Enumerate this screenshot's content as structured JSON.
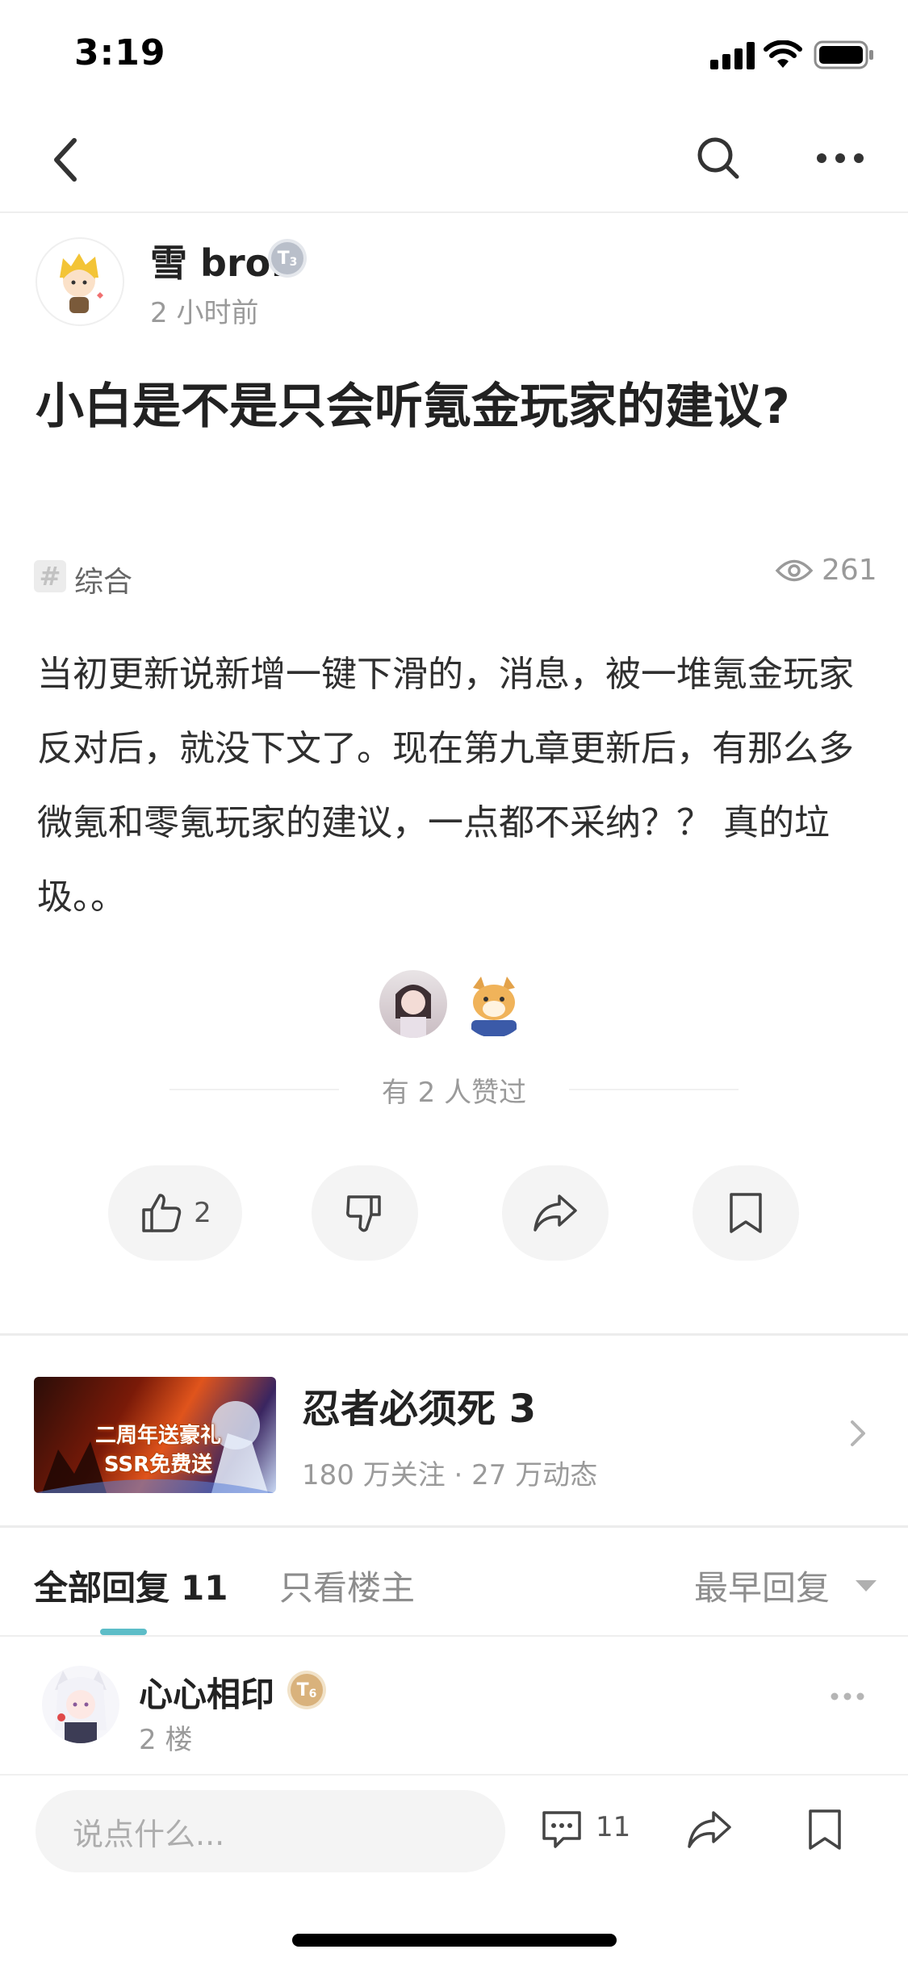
{
  "status_bar": {
    "time": "3:19"
  },
  "post": {
    "author": {
      "name": "雪 bro.",
      "level_badge": "T",
      "level_sub": "3",
      "time": "2 小时前"
    },
    "title": "小白是不是只会听氪金玩家的建议?",
    "tag": {
      "symbol": "#",
      "label": "综合"
    },
    "views": "261",
    "body": "当初更新说新增一键下滑的，消息，被一堆氪金玩家反对后，就没下文了。现在第九章更新后，有那么多微氪和零氪玩家的建议，一点都不采纳？？ 真的垃圾。。",
    "liked_text": "有 2 人赞过",
    "actions": {
      "like_count": "2"
    }
  },
  "game_card": {
    "name": "忍者必须死 3",
    "stats": "180 万关注 · 27 万动态",
    "banner_text_line1": "二周年送豪礼",
    "banner_text_line2": "SSR免费送"
  },
  "replies": {
    "tab_all_label": "全部回复",
    "tab_all_count": "11",
    "tab_host_label": "只看楼主",
    "sort_label": "最早回复",
    "items": [
      {
        "name": "心心相印",
        "level_badge": "T",
        "level_sub": "6",
        "floor": "2 楼"
      }
    ]
  },
  "bottom_bar": {
    "input_placeholder": "说点什么...",
    "comment_count": "11"
  },
  "colors": {
    "accent": "#5dbdc8",
    "badge_silver": "#b9bfca",
    "badge_gold": "#d9b27c"
  }
}
